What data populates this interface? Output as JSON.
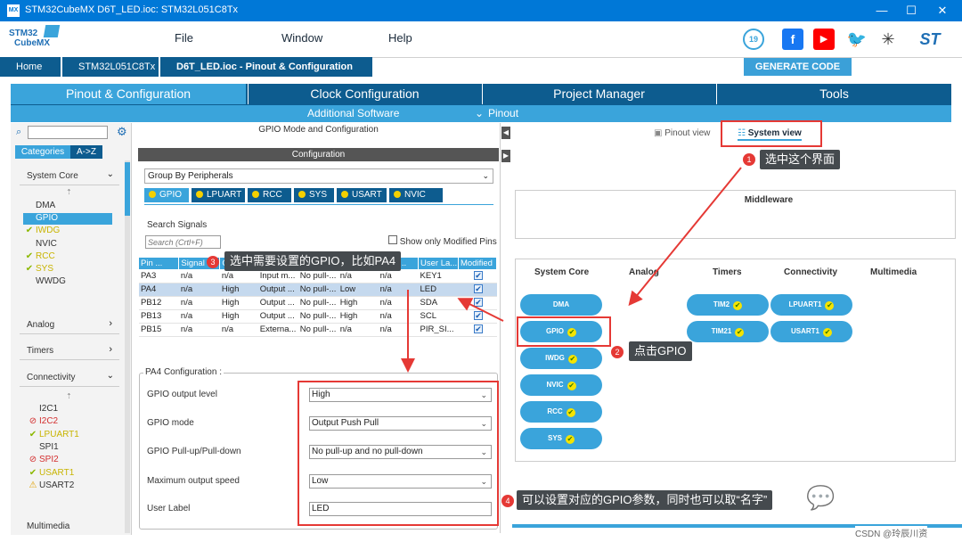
{
  "window": {
    "title": "STM32CubeMX D6T_LED.ioc: STM32L051C8Tx",
    "app_icon": "MX",
    "minimize": "—",
    "maximize": "☐",
    "close": "✕"
  },
  "logo": {
    "line1": "STM32",
    "line2": "CubeMX"
  },
  "menu": [
    "File",
    "Window",
    "Help"
  ],
  "breadcrumbs": [
    "Home",
    "STM32L051C8Tx",
    "D6T_LED.ioc - Pinout & Configuration"
  ],
  "generate_button": "GENERATE CODE",
  "main_tabs": [
    "Pinout & Configuration",
    "Clock Configuration",
    "Project Manager",
    "Tools"
  ],
  "sub_menu": {
    "software": "Additional Software",
    "pinout": "Pinout"
  },
  "left": {
    "tabs": [
      "Categories",
      "A->Z"
    ],
    "sections": {
      "system_core": "System Core",
      "analog": "Analog",
      "timers": "Timers",
      "connectivity": "Connectivity",
      "multimedia": "Multimedia"
    },
    "system_core_items": [
      {
        "label": "DMA",
        "mark": ""
      },
      {
        "label": "GPIO",
        "mark": ""
      },
      {
        "label": "IWDG",
        "mark": "✔"
      },
      {
        "label": "NVIC",
        "mark": ""
      },
      {
        "label": "RCC",
        "mark": "✔"
      },
      {
        "label": "SYS",
        "mark": "✔"
      },
      {
        "label": "WWDG",
        "mark": ""
      }
    ],
    "connectivity_items": [
      {
        "label": "I2C1",
        "mark": ""
      },
      {
        "label": "I2C2",
        "mark": "⊘"
      },
      {
        "label": "LPUART1",
        "mark": "✔"
      },
      {
        "label": "SPI1",
        "mark": ""
      },
      {
        "label": "SPI2",
        "mark": "⊘"
      },
      {
        "label": "USART1",
        "mark": "✔"
      },
      {
        "label": "USART2",
        "mark": "⚠"
      }
    ]
  },
  "middle": {
    "header": "GPIO Mode and Configuration",
    "config_bar": "Configuration",
    "group_by": "Group By Peripherals",
    "peripheral_tabs": [
      "GPIO",
      "LPUART",
      "RCC",
      "SYS",
      "USART",
      "NVIC"
    ],
    "search_label": "Search Signals",
    "search_placeholder": "Search (Crtl+F)",
    "show_modified": "Show only Modified Pins",
    "columns": [
      "Pin ...",
      "Signal",
      "GPIO ...",
      "GPIO ...",
      "GPIO ...",
      "GPIO ...",
      "Fast ...",
      "User La...",
      "Modified"
    ],
    "rows": [
      [
        "PA3",
        "n/a",
        "n/a",
        "Input m...",
        "No pull-...",
        "n/a",
        "n/a",
        "KEY1"
      ],
      [
        "PA4",
        "n/a",
        "High",
        "Output ...",
        "No pull-...",
        "Low",
        "n/a",
        "LED"
      ],
      [
        "PB12",
        "n/a",
        "High",
        "Output ...",
        "No pull-...",
        "High",
        "n/a",
        "SDA"
      ],
      [
        "PB13",
        "n/a",
        "High",
        "Output ...",
        "No pull-...",
        "High",
        "n/a",
        "SCL"
      ],
      [
        "PB15",
        "n/a",
        "n/a",
        "Externa...",
        "No pull-...",
        "n/a",
        "n/a",
        "PIR_SI..."
      ]
    ],
    "pin_config_title": "PA4 Configuration :",
    "fields": [
      {
        "label": "GPIO output level",
        "value": "High"
      },
      {
        "label": "GPIO mode",
        "value": "Output Push Pull"
      },
      {
        "label": "GPIO Pull-up/Pull-down",
        "value": "No pull-up and no pull-down"
      },
      {
        "label": "Maximum output speed",
        "value": "Low"
      },
      {
        "label": "User Label",
        "value": "LED"
      }
    ]
  },
  "right": {
    "pinout_view": "Pinout view",
    "system_view": "System view",
    "middleware": "Middleware",
    "categories": [
      "System Core",
      "Analog",
      "Timers",
      "Connectivity",
      "Multimedia"
    ],
    "system_core_pills": [
      "DMA",
      "GPIO",
      "IWDG",
      "NVIC",
      "RCC",
      "SYS"
    ],
    "timer_pills": [
      "TIM2",
      "TIM21"
    ],
    "connectivity_pills": [
      "LPUART1",
      "USART1"
    ]
  },
  "annotations": {
    "a1": {
      "num": "1",
      "text": "选中这个界面"
    },
    "a2": {
      "num": "2",
      "text": "点击GPIO"
    },
    "a3": {
      "num": "3",
      "text": "选中需要设置的GPIO，比如PA4"
    },
    "a4": {
      "num": "4",
      "text": "可以设置对应的GPIO参数，同时也可以取“名字”"
    }
  },
  "watermark": "CSDN @玲辰川资",
  "colors": {
    "titlebar": "#0078d7",
    "tab_dark": "#0d5c8f",
    "accent": "#3aa4db",
    "annotation_red": "#e53935"
  }
}
